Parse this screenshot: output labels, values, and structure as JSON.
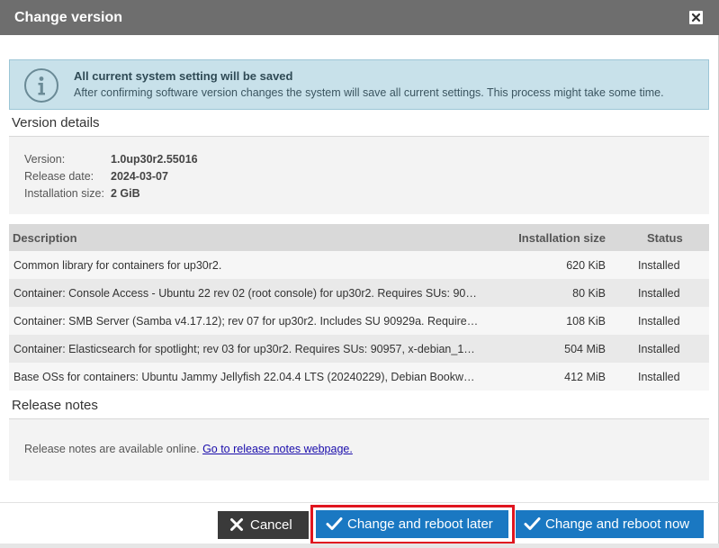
{
  "dialog": {
    "title": "Change version",
    "close_icon": "close-icon"
  },
  "info": {
    "icon": "info-icon",
    "heading": "All current system setting will be saved",
    "body": "After confirming software version changes the system will save all current settings. This process might take some time."
  },
  "version_details": {
    "section_title": "Version details",
    "version_label": "Version:",
    "version_value": "1.0up30r2.55016",
    "release_date_label": "Release date:",
    "release_date_value": "2024-03-07",
    "installation_size_label": "Installation size:",
    "installation_size_value": "2 GiB"
  },
  "components": {
    "headers": {
      "description": "Description",
      "installation_size": "Installation size",
      "status": "Status"
    },
    "rows": [
      {
        "description": "Common library for containers for up30r2.",
        "size": "620 KiB",
        "status": "Installed"
      },
      {
        "description": "Container: Console Access - Ubuntu 22 rev 02 (root console) for up30r2. Requires SUs: 90…",
        "size": "80 KiB",
        "status": "Installed"
      },
      {
        "description": "Container: SMB Server (Samba v4.17.12); rev 07 for up30r2. Includes SU 90929a. Require…",
        "size": "108 KiB",
        "status": "Installed"
      },
      {
        "description": "Container: Elasticsearch for spotlight; rev 03 for up30r2. Requires SUs: 90957, x-debian_1…",
        "size": "504 MiB",
        "status": "Installed"
      },
      {
        "description": "Base OSs for containers: Ubuntu Jammy Jellyfish 22.04.4 LTS (20240229), Debian Bookw…",
        "size": "412 MiB",
        "status": "Installed"
      }
    ]
  },
  "release_notes": {
    "section_title": "Release notes",
    "text": "Release notes are available online.",
    "link_text": "Go to release notes webpage."
  },
  "buttons": {
    "cancel": "Cancel",
    "cancel_icon": "x-icon",
    "later": "Change and reboot later",
    "later_icon": "checkmark-icon",
    "now": "Change and reboot now",
    "now_icon": "checkmark-icon"
  },
  "colors": {
    "titlebar": "#6e6e6e",
    "info_background": "#c8e1ea",
    "primary_button": "#1a78c2",
    "cancel_button": "#3a3a3a",
    "highlight": "#e0151f"
  }
}
